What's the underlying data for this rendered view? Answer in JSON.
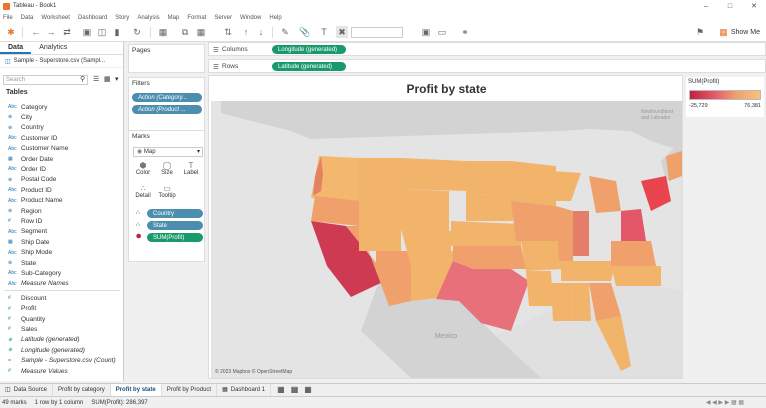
{
  "app": {
    "title": "Tableau - Book1"
  },
  "menu": [
    "File",
    "Data",
    "Worksheet",
    "Dashboard",
    "Story",
    "Analysis",
    "Map",
    "Format",
    "Server",
    "Window",
    "Help"
  ],
  "toolbar": {
    "show_me": "Show Me"
  },
  "left": {
    "tabs": [
      "Data",
      "Analytics"
    ],
    "datasource": "Sample - Superstore.csv (Sampl...",
    "search_placeholder": "Search",
    "tables_header": "Tables",
    "dimensions": [
      {
        "icon": "Abc",
        "name": "Category"
      },
      {
        "icon": "⊕",
        "name": "City"
      },
      {
        "icon": "⊕",
        "name": "Country"
      },
      {
        "icon": "Abc",
        "name": "Customer ID"
      },
      {
        "icon": "Abc",
        "name": "Customer Name"
      },
      {
        "icon": "▦",
        "name": "Order Date"
      },
      {
        "icon": "Abc",
        "name": "Order ID"
      },
      {
        "icon": "⊕",
        "name": "Postal Code"
      },
      {
        "icon": "Abc",
        "name": "Product ID"
      },
      {
        "icon": "Abc",
        "name": "Product Name"
      },
      {
        "icon": "⊕",
        "name": "Region"
      },
      {
        "icon": "#",
        "name": "Row ID"
      },
      {
        "icon": "Abc",
        "name": "Segment"
      },
      {
        "icon": "▦",
        "name": "Ship Date"
      },
      {
        "icon": "Abc",
        "name": "Ship Mode"
      },
      {
        "icon": "⊕",
        "name": "State"
      },
      {
        "icon": "Abc",
        "name": "Sub-Category"
      },
      {
        "icon": "Abc",
        "name": "Measure Names"
      }
    ],
    "measures": [
      {
        "icon": "#",
        "name": "Discount"
      },
      {
        "icon": "#",
        "name": "Profit"
      },
      {
        "icon": "#",
        "name": "Quantity"
      },
      {
        "icon": "#",
        "name": "Sales"
      },
      {
        "icon": "⊕",
        "name": "Latitude (generated)"
      },
      {
        "icon": "⊕",
        "name": "Longitude (generated)"
      },
      {
        "icon": "=",
        "name": "Sample - Superstore.csv (Count)"
      },
      {
        "icon": "#",
        "name": "Measure Values"
      }
    ]
  },
  "shelves": {
    "pages": "Pages",
    "filters": "Filters",
    "filter_pills": [
      "Action (Category...",
      "Action (Product ..."
    ],
    "marks": "Marks",
    "mark_type": "Map",
    "mark_buttons": [
      "Color",
      "Size",
      "Label",
      "Detail",
      "Tooltip"
    ],
    "mark_pills": [
      "Country",
      "State",
      "SUM(Profit)"
    ],
    "columns_label": "Columns",
    "columns_pill": "Longitude (generated)",
    "rows_label": "Rows",
    "rows_pill": "Latitude (generated)"
  },
  "view": {
    "title": "Profit by state",
    "credit": "© 2023 Mapbox © OpenStreetMap",
    "map_labels": [
      "Mexico",
      "Newfoundland and Labrador"
    ]
  },
  "legend": {
    "title": "SUM(Profit)",
    "min": "-25,729",
    "max": "76,381"
  },
  "sheet_tabs": [
    "Data Source",
    "Profit by category",
    "Profit by state",
    "Profit by Product",
    "Dashboard 1"
  ],
  "status": {
    "marks": "49 marks",
    "rows": "1 row by 1 column",
    "sum": "SUM(Profit): 286,397"
  },
  "colors": {
    "accent": "#1f77b4",
    "pill_blue": "#4b8eb0",
    "pill_green": "#1a9a6c",
    "low": "#c2203f",
    "high": "#f7c37a"
  }
}
